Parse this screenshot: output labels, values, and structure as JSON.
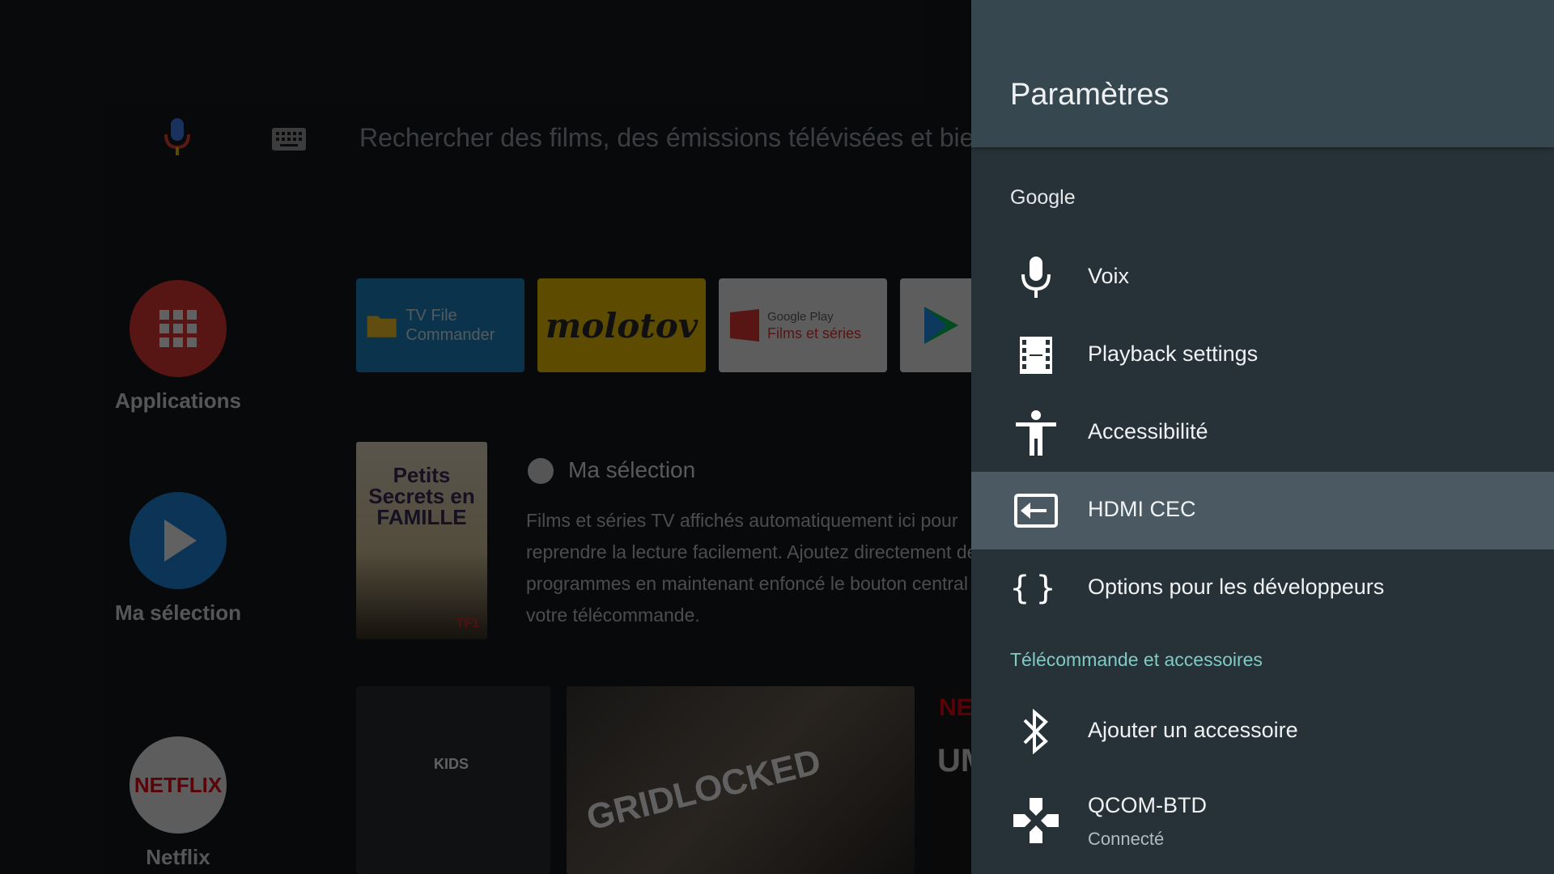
{
  "launcher": {
    "search_placeholder": "Rechercher des films, des émissions télévisées et bie",
    "side_items": [
      {
        "label": "Applications",
        "color": "#e53935"
      },
      {
        "label": "Ma sélection",
        "color": "#1e88e5"
      },
      {
        "label": "Netflix",
        "color": "#f5f5f5"
      }
    ],
    "app_tiles": {
      "file_commander": "TV File Commander",
      "molotov": "molotov",
      "google_play_line1": "Google Play",
      "google_play_line2": "Films et séries"
    },
    "poster": {
      "title": "Petits Secrets en FAMILLE",
      "channel": "TF1"
    },
    "selection": {
      "title": "Ma sélection",
      "description": "Films et séries TV affichés automatiquement ici pour reprendre la lecture facilement. Ajoutez directement des programmes en maintenant enfoncé le bouton central de votre télécommande."
    },
    "bottom_tiles": {
      "kids": "KIDS",
      "gridlocked": "GRIDLOCKED",
      "netflix": "NETFLIX",
      "partial": "UM"
    }
  },
  "settings": {
    "title": "Paramètres",
    "section_google": "Google",
    "section_remote": "Télécommande et accessoires",
    "accent_color": "#80cbc4",
    "items": [
      {
        "label": "Voix",
        "icon": "mic-icon"
      },
      {
        "label": "Playback settings",
        "icon": "film-icon"
      },
      {
        "label": "Accessibilité",
        "icon": "accessibility-icon"
      },
      {
        "label": "HDMI CEC",
        "icon": "input-icon",
        "focused": true
      },
      {
        "label": "Options pour les développeurs",
        "icon": "braces-icon"
      },
      {
        "label": "Ajouter un accessoire",
        "icon": "bluetooth-icon"
      },
      {
        "label": "QCOM-BTD",
        "sublabel": "Connecté",
        "icon": "gamepad-icon"
      }
    ]
  }
}
